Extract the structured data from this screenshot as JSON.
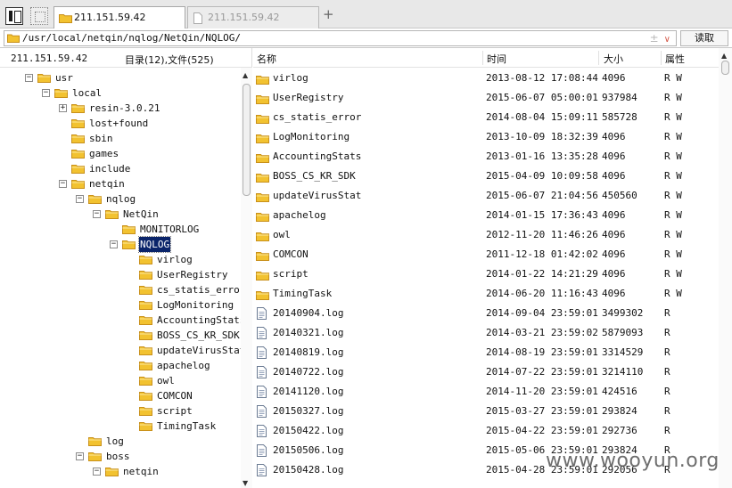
{
  "tabs": [
    {
      "label": "211.151.59.42",
      "active": true
    },
    {
      "label": "211.151.59.42",
      "active": false
    }
  ],
  "tab_add_label": "+",
  "path": {
    "value": "/usr/local/netqin/nqlog/NetQin/NQLOG/",
    "sort_glyph": "±",
    "dropdown_glyph": "∨",
    "read_label": "读取"
  },
  "left": {
    "host": "211.151.59.42",
    "count_label": "目录(12),文件(525)",
    "tree": [
      {
        "label": "usr",
        "level": 0,
        "exp": "−"
      },
      {
        "label": "local",
        "level": 1,
        "exp": "−"
      },
      {
        "label": "resin-3.0.21",
        "level": 2,
        "exp": "+"
      },
      {
        "label": "lost+found",
        "level": 2,
        "exp": ""
      },
      {
        "label": "sbin",
        "level": 2,
        "exp": ""
      },
      {
        "label": "games",
        "level": 2,
        "exp": ""
      },
      {
        "label": "include",
        "level": 2,
        "exp": ""
      },
      {
        "label": "netqin",
        "level": 2,
        "exp": "−"
      },
      {
        "label": "nqlog",
        "level": 3,
        "exp": "−"
      },
      {
        "label": "NetQin",
        "level": 4,
        "exp": "−"
      },
      {
        "label": "MONITORLOG",
        "level": 5,
        "exp": ""
      },
      {
        "label": "NQLOG",
        "level": 5,
        "exp": "−",
        "selected": true
      },
      {
        "label": "virlog",
        "level": 6,
        "exp": ""
      },
      {
        "label": "UserRegistry",
        "level": 6,
        "exp": ""
      },
      {
        "label": "cs_statis_error",
        "level": 6,
        "exp": ""
      },
      {
        "label": "LogMonitoring",
        "level": 6,
        "exp": ""
      },
      {
        "label": "AccountingStats",
        "level": 6,
        "exp": ""
      },
      {
        "label": "BOSS_CS_KR_SDK",
        "level": 6,
        "exp": ""
      },
      {
        "label": "updateVirusStat",
        "level": 6,
        "exp": ""
      },
      {
        "label": "apachelog",
        "level": 6,
        "exp": ""
      },
      {
        "label": "owl",
        "level": 6,
        "exp": ""
      },
      {
        "label": "COMCON",
        "level": 6,
        "exp": ""
      },
      {
        "label": "script",
        "level": 6,
        "exp": ""
      },
      {
        "label": "TimingTask",
        "level": 6,
        "exp": ""
      },
      {
        "label": "log",
        "level": 3,
        "exp": ""
      },
      {
        "label": "boss",
        "level": 3,
        "exp": "−"
      },
      {
        "label": "netqin",
        "level": 4,
        "exp": "−"
      }
    ]
  },
  "columns": {
    "name": "名称",
    "time": "时间",
    "size": "大小",
    "attr": "属性"
  },
  "files": [
    {
      "name": "virlog",
      "time": "2013-08-12 17:08:44",
      "size": "4096",
      "attr": "R W",
      "type": "folder"
    },
    {
      "name": "UserRegistry",
      "time": "2015-06-07 05:00:01",
      "size": "937984",
      "attr": "R W",
      "type": "folder"
    },
    {
      "name": "cs_statis_error",
      "time": "2014-08-04 15:09:11",
      "size": "585728",
      "attr": "R W",
      "type": "folder"
    },
    {
      "name": "LogMonitoring",
      "time": "2013-10-09 18:32:39",
      "size": "4096",
      "attr": "R W",
      "type": "folder"
    },
    {
      "name": "AccountingStats",
      "time": "2013-01-16 13:35:28",
      "size": "4096",
      "attr": "R W",
      "type": "folder"
    },
    {
      "name": "BOSS_CS_KR_SDK",
      "time": "2015-04-09 10:09:58",
      "size": "4096",
      "attr": "R W",
      "type": "folder"
    },
    {
      "name": "updateVirusStat",
      "time": "2015-06-07 21:04:56",
      "size": "450560",
      "attr": "R W",
      "type": "folder"
    },
    {
      "name": "apachelog",
      "time": "2014-01-15 17:36:43",
      "size": "4096",
      "attr": "R W",
      "type": "folder"
    },
    {
      "name": "owl",
      "time": "2012-11-20 11:46:26",
      "size": "4096",
      "attr": "R W",
      "type": "folder"
    },
    {
      "name": "COMCON",
      "time": "2011-12-18 01:42:02",
      "size": "4096",
      "attr": "R W",
      "type": "folder"
    },
    {
      "name": "script",
      "time": "2014-01-22 14:21:29",
      "size": "4096",
      "attr": "R W",
      "type": "folder"
    },
    {
      "name": "TimingTask",
      "time": "2014-06-20 11:16:43",
      "size": "4096",
      "attr": "R W",
      "type": "folder"
    },
    {
      "name": "20140904.log",
      "time": "2014-09-04 23:59:01",
      "size": "3499302",
      "attr": "R",
      "type": "file"
    },
    {
      "name": "20140321.log",
      "time": "2014-03-21 23:59:02",
      "size": "5879093",
      "attr": "R",
      "type": "file"
    },
    {
      "name": "20140819.log",
      "time": "2014-08-19 23:59:01",
      "size": "3314529",
      "attr": "R",
      "type": "file"
    },
    {
      "name": "20140722.log",
      "time": "2014-07-22 23:59:01",
      "size": "3214110",
      "attr": "R",
      "type": "file"
    },
    {
      "name": "20141120.log",
      "time": "2014-11-20 23:59:01",
      "size": "424516",
      "attr": "R",
      "type": "file"
    },
    {
      "name": "20150327.log",
      "time": "2015-03-27 23:59:01",
      "size": "293824",
      "attr": "R",
      "type": "file"
    },
    {
      "name": "20150422.log",
      "time": "2015-04-22 23:59:01",
      "size": "292736",
      "attr": "R",
      "type": "file"
    },
    {
      "name": "20150506.log",
      "time": "2015-05-06 23:59:01",
      "size": "293824",
      "attr": "R",
      "type": "file"
    },
    {
      "name": "20150428.log",
      "time": "2015-04-28 23:59:01",
      "size": "292056",
      "attr": "R",
      "type": "file"
    }
  ],
  "watermark": "www.wooyun.org",
  "colors": {
    "folder": "#f2c230",
    "folder_edge": "#c8901a",
    "selection": "#0a246a"
  }
}
